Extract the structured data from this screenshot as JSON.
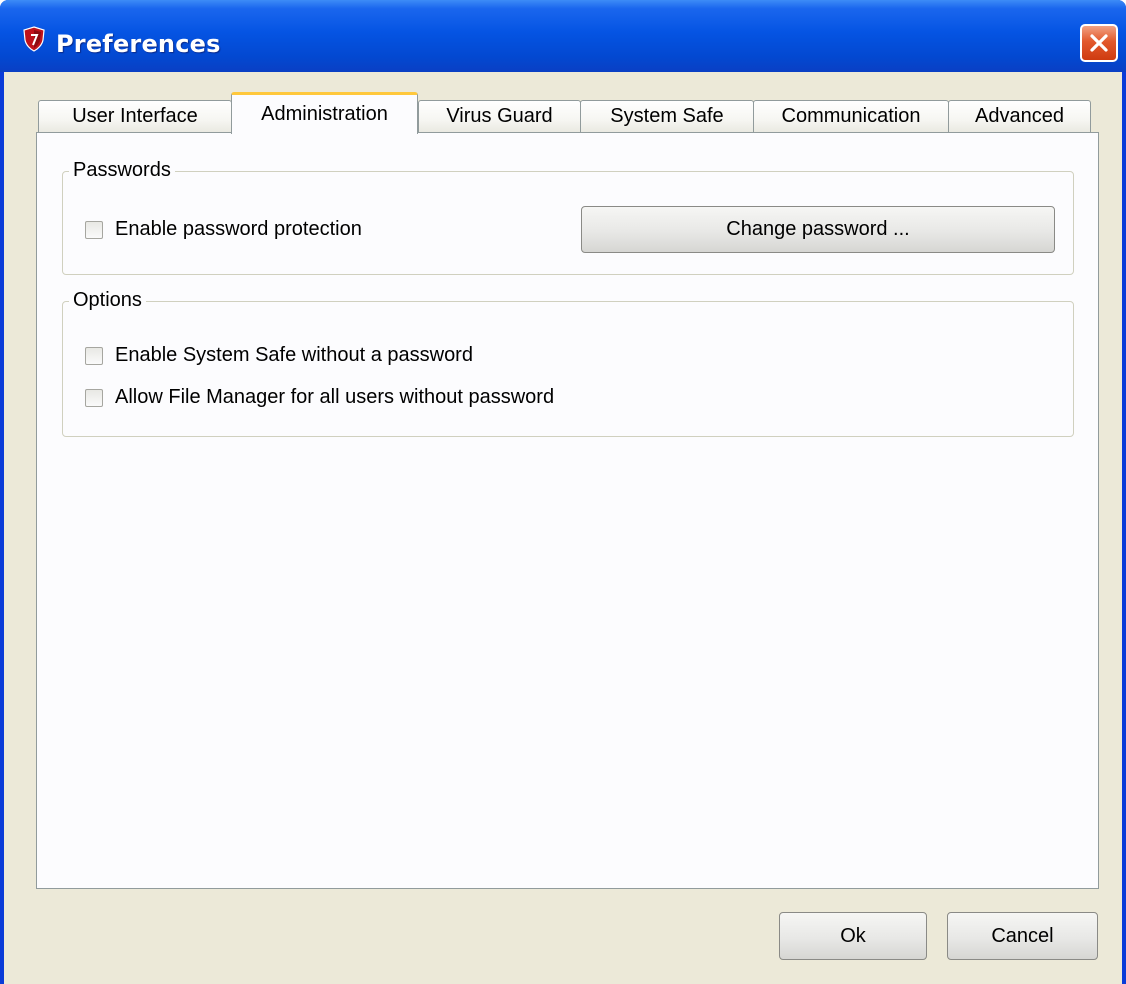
{
  "window": {
    "title": "Preferences",
    "close_icon": "close-icon",
    "app_icon": "shield-icon"
  },
  "tabs": [
    {
      "label": "User Interface",
      "active": false
    },
    {
      "label": "Administration",
      "active": true
    },
    {
      "label": "Virus Guard",
      "active": false
    },
    {
      "label": "System Safe",
      "active": false
    },
    {
      "label": "Communication",
      "active": false
    },
    {
      "label": "Advanced",
      "active": false
    }
  ],
  "passwords": {
    "legend": "Passwords",
    "enable_protection": {
      "label": "Enable password protection",
      "checked": false
    },
    "change_button": "Change password ..."
  },
  "options": {
    "legend": "Options",
    "items": [
      {
        "label": "Enable System Safe without a password",
        "checked": false
      },
      {
        "label": "Allow File Manager for all users without password",
        "checked": false
      }
    ]
  },
  "footer": {
    "ok_label": "Ok",
    "cancel_label": "Cancel"
  },
  "colors": {
    "titlebar": "#0554e3",
    "close_button": "#e2592c",
    "dialog_background": "#ece9d8",
    "active_tab_highlight": "#ffc83c"
  }
}
